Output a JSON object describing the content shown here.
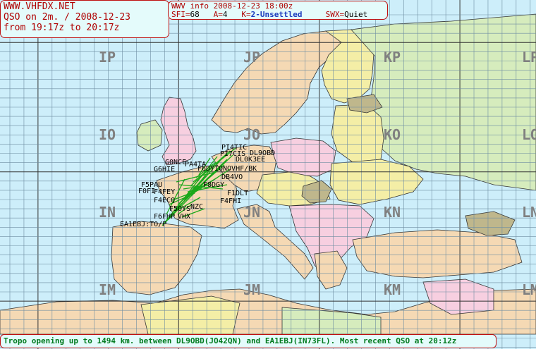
{
  "header": {
    "site": "WWW.VHFDX.NET",
    "line2": "QSO on 2m. / 2008-12-23",
    "line3": "from 19:17z to 20:17z"
  },
  "wwv": {
    "title": "WWV info 2008-12-23 18:00z",
    "sfi_label": "SFI=",
    "sfi": "68",
    "a_label": "A=",
    "a": "4",
    "k_label": "K=",
    "k": "2-Unsettled",
    "swx_label": "SWX=",
    "swx": "Quiet"
  },
  "grid_labels": [
    "IP",
    "JP",
    "KP",
    "LP",
    "IO",
    "JO",
    "KO",
    "LO",
    "IN",
    "JN",
    "KN",
    "LN",
    "IM",
    "JM",
    "KM",
    "LM"
  ],
  "stations": [
    "PI4TIC",
    "PI7CIS",
    "DL9OBD",
    "DL0K3EE",
    "G0NCE",
    "G6HIE",
    "PA4TA",
    "F6DYI",
    "ONOVHF/BK",
    "DB4VO",
    "F5PAU",
    "F0FI",
    "F4FEY",
    "F8DGY",
    "F1DLT",
    "F4ECQ",
    "F4FHI",
    "F5OYS",
    "NZC",
    "F6FHP",
    "VHX",
    "EA1EBJ:TO/P"
  ],
  "status": "Tropo opening up to 1494 km. between DL9OBD(JO42QN) and EA1EBJ(IN73FL). Most recent QSO at 20:12z",
  "colors": {
    "sea": "#cdeefa",
    "land": "#f5d9b4",
    "pink": "#f7cfe0",
    "green": "#d6ecbd",
    "yellow": "#f4eea6",
    "olive": "#bfb78c",
    "grid": "#7a96a8",
    "qso": "#1aa81a"
  }
}
